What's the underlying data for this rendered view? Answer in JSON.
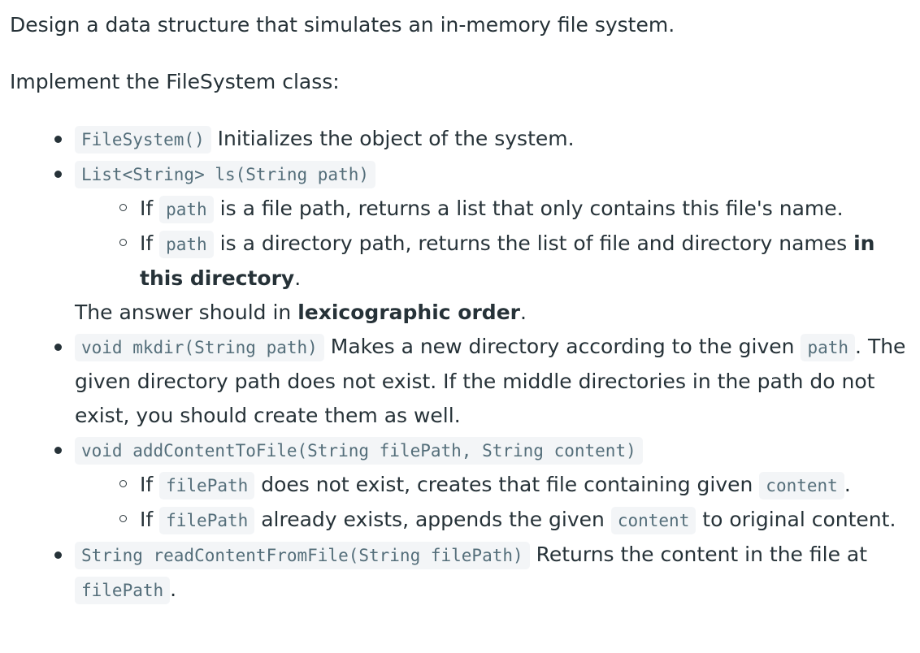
{
  "intro": "Design a data structure that simulates an in-memory file system.",
  "implement": "Implement the FileSystem class:",
  "items": [
    {
      "code": "FileSystem()",
      "text": " Initializes the object of the system."
    },
    {
      "code": "List<String> ls(String path)",
      "sub": [
        {
          "pre": "If ",
          "code": "path",
          "text": " is a file path, returns a list that only contains this file's name."
        },
        {
          "pre": "If ",
          "code": "path",
          "text": " is a directory path, returns the list of file and directory names ",
          "bold": "in this directory",
          "post": "."
        }
      ],
      "note_pre": "The answer should in ",
      "note_bold": "lexicographic order",
      "note_post": "."
    },
    {
      "code": "void mkdir(String path)",
      "text": " Makes a new directory according to the given ",
      "code2": "path",
      "text2": ". The given directory path does not exist. If the middle directories in the path do not exist, you should create them as well."
    },
    {
      "code": "void addContentToFile(String filePath, String content)",
      "sub": [
        {
          "pre": "If ",
          "code": "filePath",
          "text": " does not exist, creates that file containing given ",
          "code2": "content",
          "post": "."
        },
        {
          "pre": "If ",
          "code": "filePath",
          "text": " already exists, appends the given ",
          "code2": "content",
          "post": " to original content."
        }
      ]
    },
    {
      "code": "String readContentFromFile(String filePath)",
      "text": " Returns the content in the file at ",
      "code2": "filePath",
      "post": "."
    }
  ]
}
